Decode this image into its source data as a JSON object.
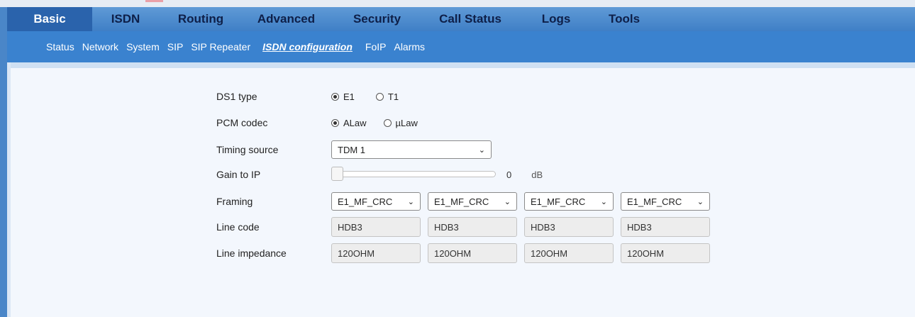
{
  "main_nav": {
    "tabs": [
      {
        "label": "Basic",
        "active": true
      },
      {
        "label": "ISDN",
        "active": false
      },
      {
        "label": "Routing",
        "active": false
      },
      {
        "label": "Advanced",
        "active": false
      },
      {
        "label": "Security",
        "active": false
      },
      {
        "label": "Call Status",
        "active": false
      },
      {
        "label": "Logs",
        "active": false
      },
      {
        "label": "Tools",
        "active": false
      }
    ]
  },
  "sub_nav": {
    "links": [
      {
        "label": "Status",
        "active": false
      },
      {
        "label": "Network",
        "active": false
      },
      {
        "label": "System",
        "active": false
      },
      {
        "label": "SIP",
        "active": false
      },
      {
        "label": "SIP Repeater",
        "active": false
      },
      {
        "label": "ISDN configuration",
        "active": true
      },
      {
        "label": "FoIP",
        "active": false
      },
      {
        "label": "Alarms",
        "active": false
      }
    ]
  },
  "form": {
    "ds1_type": {
      "label": "DS1 type",
      "options": [
        "E1",
        "T1"
      ],
      "selected": "E1"
    },
    "pcm_codec": {
      "label": "PCM codec",
      "options": [
        "ALaw",
        "µLaw"
      ],
      "selected": "ALaw"
    },
    "timing_source": {
      "label": "Timing source",
      "value": "TDM 1"
    },
    "gain_to_ip": {
      "label": "Gain to IP",
      "value": "0",
      "unit": "dB",
      "level": 0
    },
    "framing": {
      "label": "Framing",
      "values": [
        "E1_MF_CRC",
        "E1_MF_CRC",
        "E1_MF_CRC",
        "E1_MF_CRC"
      ]
    },
    "line_code": {
      "label": "Line code",
      "values": [
        "HDB3",
        "HDB3",
        "HDB3",
        "HDB3"
      ]
    },
    "line_impedance": {
      "label": "Line impedance",
      "values": [
        "120OHM",
        "120OHM",
        "120OHM",
        "120OHM"
      ]
    }
  },
  "icons": {
    "dropdown": "chevron-down-icon"
  }
}
